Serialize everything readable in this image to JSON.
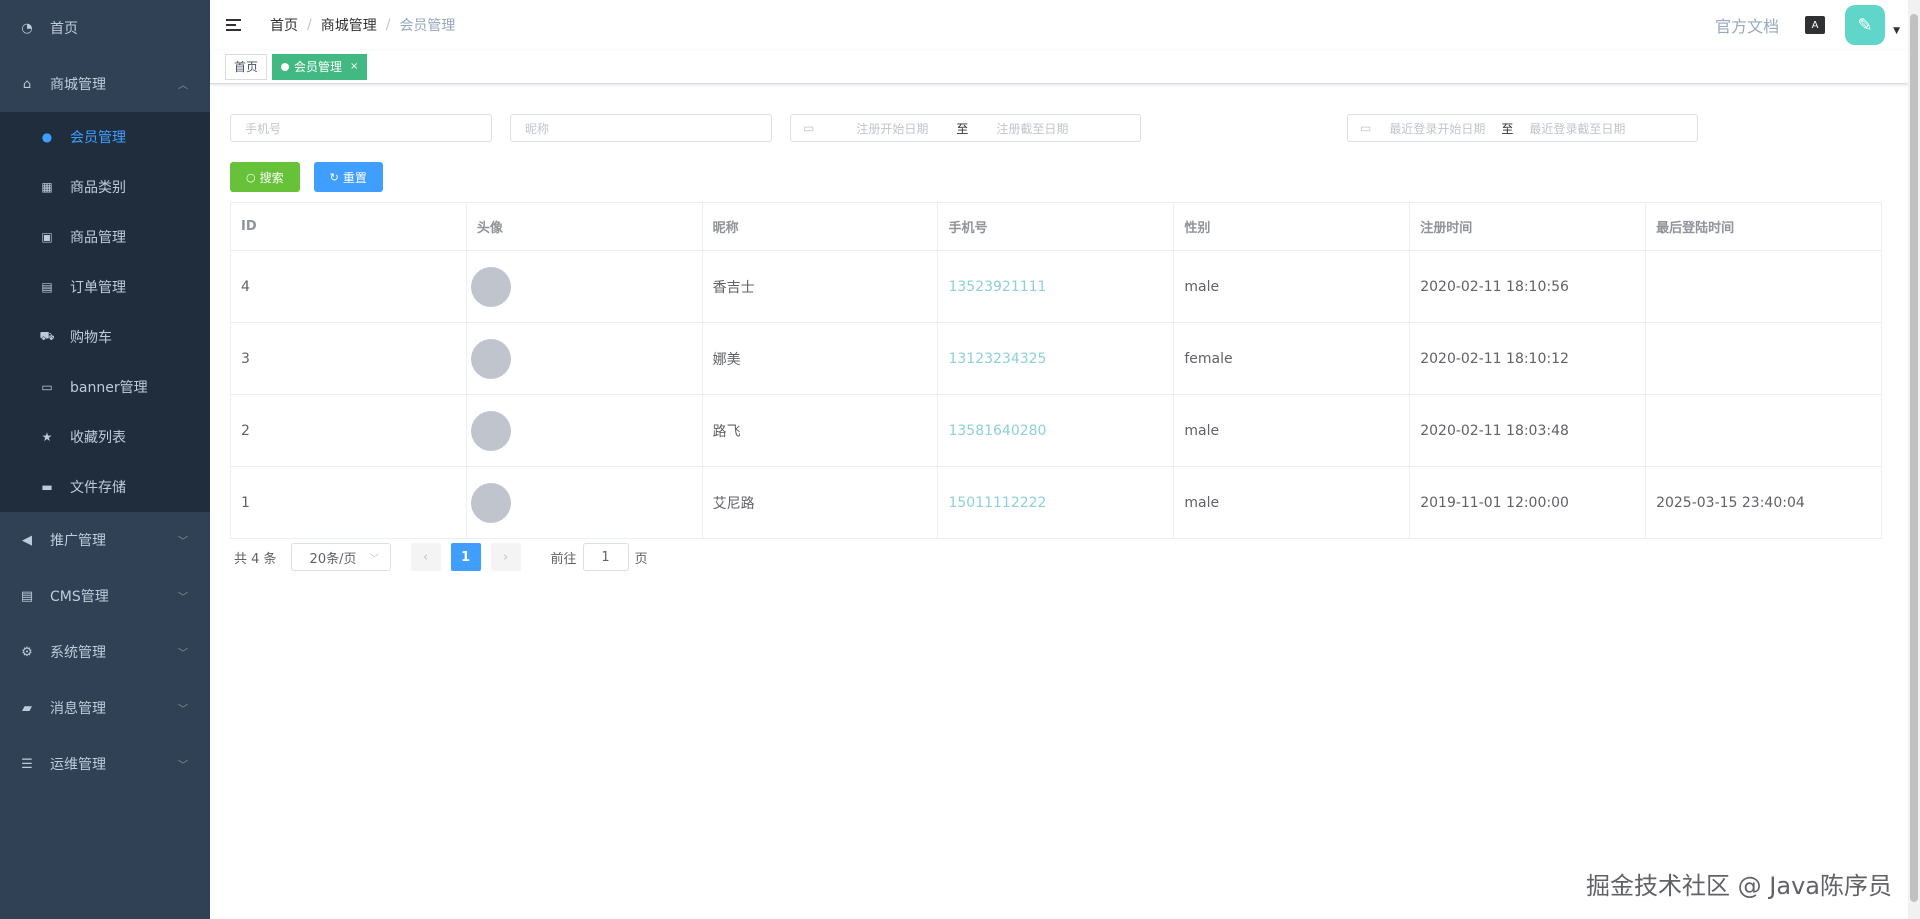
{
  "sidebar": {
    "home": {
      "label": "首页",
      "icon": "dashboard-icon"
    },
    "mall": {
      "label": "商城管理",
      "icon": "shop-icon",
      "items": [
        {
          "label": "会员管理",
          "icon": "user-icon",
          "active": true
        },
        {
          "label": "商品类别",
          "icon": "grid-icon"
        },
        {
          "label": "商品管理",
          "icon": "goods-icon"
        },
        {
          "label": "订单管理",
          "icon": "clipboard-icon"
        },
        {
          "label": "购物车",
          "icon": "cart-icon"
        },
        {
          "label": "banner管理",
          "icon": "ad-icon"
        },
        {
          "label": "收藏列表",
          "icon": "star-icon"
        },
        {
          "label": "文件存储",
          "icon": "folder-icon"
        }
      ]
    },
    "groups": [
      {
        "label": "推广管理",
        "icon": "megaphone-icon"
      },
      {
        "label": "CMS管理",
        "icon": "document-icon"
      },
      {
        "label": "系统管理",
        "icon": "gear-icon"
      },
      {
        "label": "消息管理",
        "icon": "message-icon"
      },
      {
        "label": "运维管理",
        "icon": "server-icon"
      }
    ]
  },
  "header": {
    "breadcrumb": [
      "首页",
      "商城管理",
      "会员管理"
    ],
    "doc_link": "官方文档",
    "lang_icon_text": "A"
  },
  "tags": [
    {
      "label": "首页",
      "active": false
    },
    {
      "label": "会员管理",
      "active": true,
      "close": "×"
    }
  ],
  "filters": {
    "phone_placeholder": "手机号",
    "nickname_placeholder": "昵称",
    "reg_start": "注册开始日期",
    "reg_sep": "至",
    "reg_end": "注册截至日期",
    "login_start": "最近登录开始日期",
    "login_sep": "至",
    "login_end": "最近登录截至日期"
  },
  "buttons": {
    "search": "搜索",
    "reset": "重置"
  },
  "table": {
    "columns": [
      "ID",
      "头像",
      "昵称",
      "手机号",
      "性别",
      "注册时间",
      "最后登陆时间"
    ],
    "rows": [
      {
        "id": "4",
        "nickname": "香吉士",
        "phone": "13523921111",
        "gender": "male",
        "registered": "2020-02-11 18:10:56",
        "last_login": ""
      },
      {
        "id": "3",
        "nickname": "娜美",
        "phone": "13123234325",
        "gender": "female",
        "registered": "2020-02-11 18:10:12",
        "last_login": ""
      },
      {
        "id": "2",
        "nickname": "路飞",
        "phone": "13581640280",
        "gender": "male",
        "registered": "2020-02-11 18:03:48",
        "last_login": ""
      },
      {
        "id": "1",
        "nickname": "艾尼路",
        "phone": "15011112222",
        "gender": "male",
        "registered": "2019-11-01 12:00:00",
        "last_login": "2025-03-15 23:40:04"
      }
    ]
  },
  "pagination": {
    "total": "共 4 条",
    "page_size": "20条/页",
    "current_page": "1",
    "goto_prefix": "前往",
    "goto_value": "1",
    "goto_suffix": "页"
  },
  "watermark": "掘金技术社区 @ Java陈序员",
  "colors": {
    "sidebar_bg": "#304156",
    "submenu_bg": "#1f2d3d",
    "active": "#409eff",
    "tag_active": "#42b983",
    "success": "#67c23a"
  }
}
